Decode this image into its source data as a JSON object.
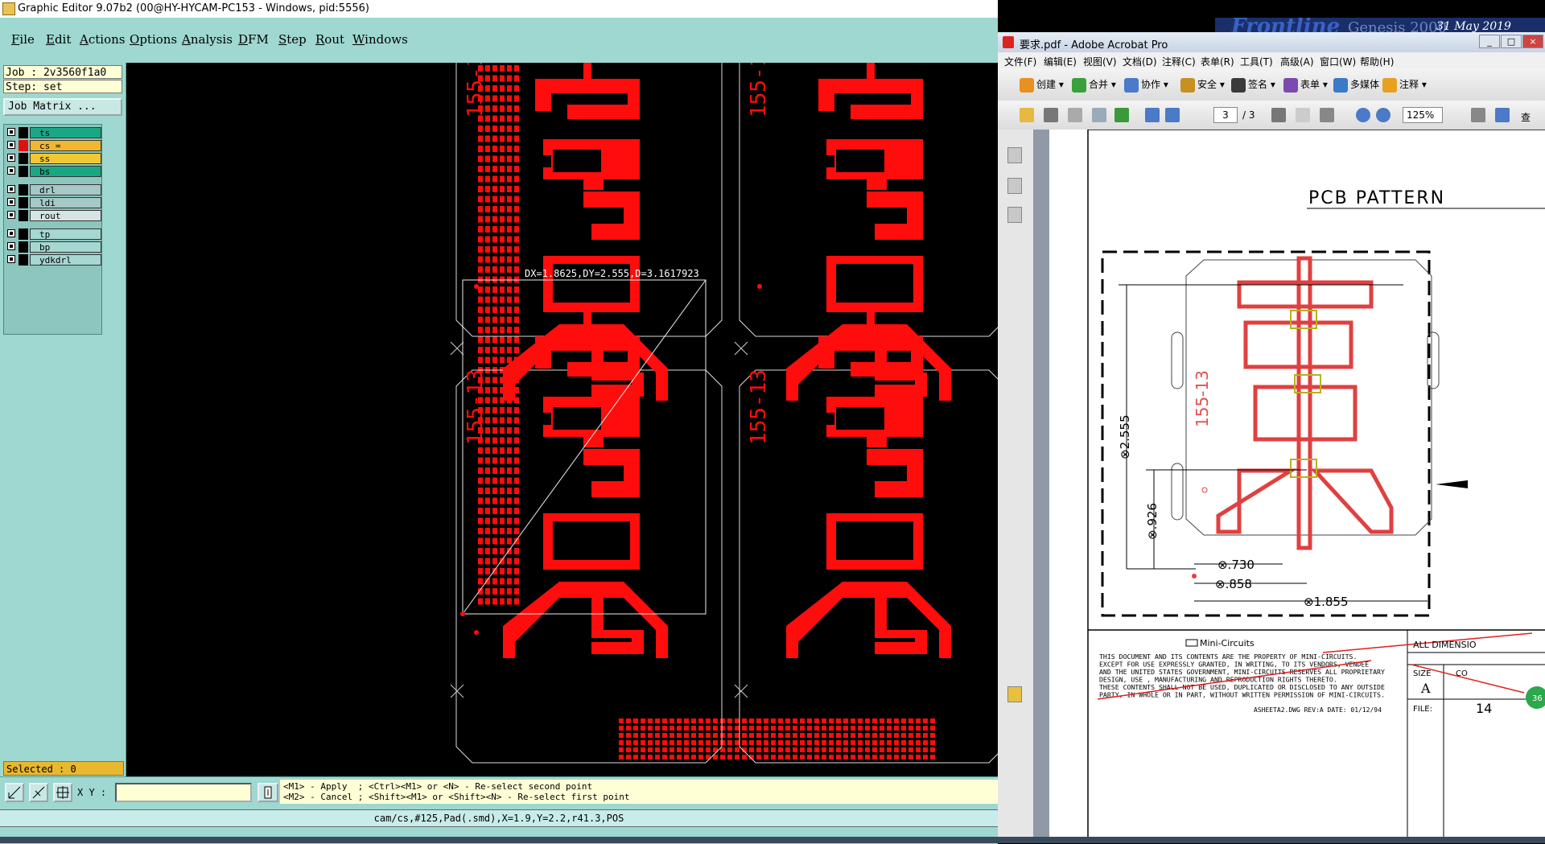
{
  "genesis": {
    "title": "Graphic Editor 9.07b2 (00@HY-HYCAM-PC153 - Windows, pid:5556)",
    "menu": [
      "File",
      "Edit",
      "Actions",
      "Options",
      "Analysis",
      "DFM",
      "Step",
      "Rout",
      "Windows"
    ],
    "job": "Job : 2v3560f1a0",
    "step": "Step: set",
    "job_matrix": "Job Matrix ...",
    "layers": [
      {
        "name": "ts",
        "color": "#1aa884",
        "mark": ""
      },
      {
        "name": "cs",
        "color": "#f0b830",
        "mark": "="
      },
      {
        "name": "ss",
        "color": "#f0c832",
        "mark": ""
      },
      {
        "name": "bs",
        "color": "#1aa884",
        "mark": ""
      },
      {
        "name": "drl",
        "color": "#a6c8c6",
        "mark": ""
      },
      {
        "name": "ldi",
        "color": "#a6c8c6",
        "mark": ""
      },
      {
        "name": "rout",
        "color": "#d4e4e2",
        "mark": ""
      },
      {
        "name": "tp",
        "color": "#a6d8d2",
        "mark": ""
      },
      {
        "name": "bp",
        "color": "#a6d8d2",
        "mark": ""
      },
      {
        "name": "ydkdrl",
        "color": "#a6d8d2",
        "mark": ""
      }
    ],
    "selected": "Selected : 0",
    "xy_label": "X Y :",
    "xy_value": "",
    "help_line1": "<M1> - Apply  ; <Ctrl><M1> or <N> - Re-select second point",
    "help_line2": "<M2> - Cancel ; <Shift><M1> or <Shift><N> - Re-select first point",
    "status": "cam/cs,#125,Pad(.smd),X=1.9,Y=2.2,r41.3,POS",
    "measure": "DX=1.8625,DY=2.555,D=3.1617923",
    "board_label": "155-13",
    "board_label_top": "155-1"
  },
  "frontline": {
    "brand": "Frontline",
    "product": "Genesis 2000",
    "date": "31 May 2019"
  },
  "acrobat": {
    "title": "要求.pdf - Adobe Acrobat Pro",
    "menu": [
      "文件(F)",
      "编辑(E)",
      "视图(V)",
      "文档(D)",
      "注释(C)",
      "表单(R)",
      "工具(T)",
      "高级(A)",
      "窗口(W)",
      "帮助(H)"
    ],
    "toolbar": [
      "创建",
      "合并",
      "协作",
      "安全",
      "签名",
      "表单",
      "多媒体",
      "注释"
    ],
    "page_current": "3",
    "page_total": "/ 3",
    "zoom": "125%",
    "search_hint": "查",
    "pdf": {
      "heading": "PCB PATTERN",
      "label": "155-13",
      "dims": [
        "⊗2.555",
        "⊗.926",
        "⊗.730",
        "⊗.858",
        "⊗1.855"
      ],
      "company": "Mini-Circuits",
      "notice": [
        "THIS DOCUMENT AND ITS CONTENTS ARE THE PROPERTY OF MINI-CIRCUITS.",
        "EXCEPT FOR USE EXPRESSLY GRANTED, IN WRITING, TO ITS VENDORS, VENDEE",
        "AND THE UNITED STATES GOVERNMENT, MINI-CIRCUITS RESERVES ALL PROPRIETARY",
        "DESIGN, USE , MANUFACTURING AND REPRODUCTION RIGHTS THERETO.",
        "THESE CONTENTS SHALL NOT BE USED, DUPLICATED OR DISCLOSED TO ANY OUTSIDE",
        "PARTY, IN WHOLE OR IN PART, WITHOUT WRITTEN PERMISSION OF MINI-CIRCUITS."
      ],
      "all_dims": "ALL DIMENSIO",
      "size_label": "SIZE",
      "size_value": "A",
      "code_label": "CO",
      "file_label": "FILE:",
      "file_value": "14",
      "dwg": "ASHEETA2.DWG  REV:A   DATE: 01/12/94",
      "badge": "36"
    }
  }
}
